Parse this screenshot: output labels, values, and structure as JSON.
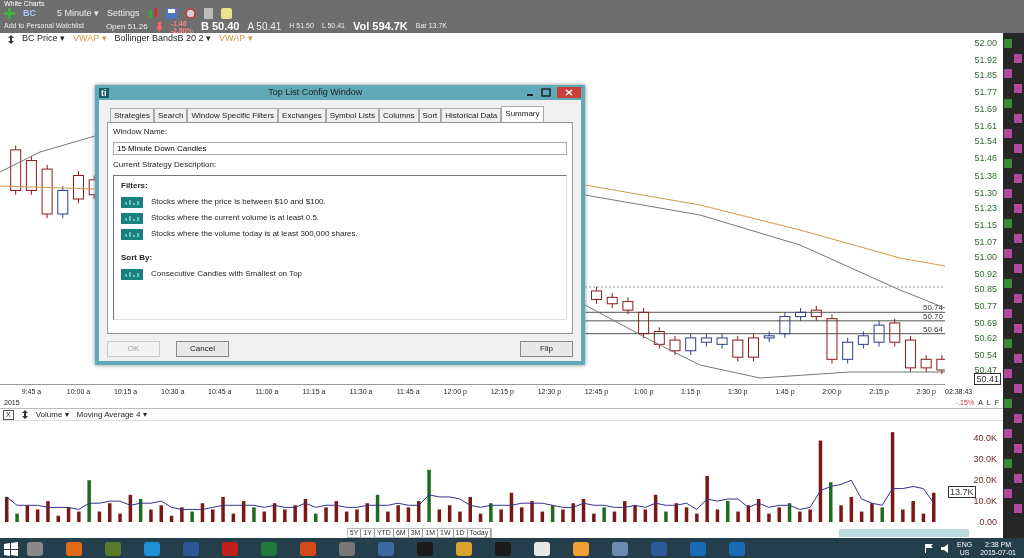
{
  "app_title": "White Charts",
  "toolbar": {
    "symbol": "BC",
    "interval": "5 Minute ▾",
    "settings": "Settings"
  },
  "quote": {
    "watchlist_link": "Add to Personal Watchlist",
    "open": "Open 51.26",
    "change": "-1.46",
    "change_pct": "-2.80%",
    "bid": "B 50.40",
    "ask": "A 50.41",
    "high": "H 51.50",
    "low": "L 50.41",
    "volume": "Vol 594.7K",
    "bar": "Bar 13.7K"
  },
  "price_chart": {
    "indicators": [
      {
        "label": "BC Price ▾"
      },
      {
        "label": "VWAP ▾",
        "color": "#d19a45"
      },
      {
        "label": "Bollinger BandsB 20 2 ▾"
      },
      {
        "label": "VWAP ▾",
        "color": "#d19a45"
      }
    ],
    "level_labels": [
      "50.74",
      "50.70",
      "50.64"
    ],
    "last_price": "50.41",
    "change_pct": "-.15%",
    "time": "02:38:43",
    "flags": [
      "A",
      "L",
      "F"
    ],
    "year": "2015",
    "chart_data": {
      "type": "candlestick",
      "x": [
        580,
        585,
        590,
        595,
        600,
        605,
        765,
        770,
        775,
        780,
        785,
        790,
        795,
        800,
        805,
        810,
        815,
        820,
        825,
        830,
        835,
        840,
        845,
        850,
        855,
        860,
        865,
        870,
        875
      ],
      "ohlc": [
        [
          51.5,
          51.52,
          51.29,
          51.31
        ],
        [
          51.45,
          51.47,
          51.29,
          51.31
        ],
        [
          51.41,
          51.43,
          51.18,
          51.2
        ],
        [
          51.2,
          51.33,
          51.18,
          51.31
        ],
        [
          51.38,
          51.4,
          51.25,
          51.27
        ],
        [
          51.36,
          51.38,
          51.27,
          51.29
        ],
        [
          50.84,
          50.86,
          50.78,
          50.8
        ],
        [
          50.81,
          50.83,
          50.76,
          50.78
        ],
        [
          50.79,
          50.81,
          50.73,
          50.75
        ],
        [
          50.74,
          50.76,
          50.62,
          50.64
        ],
        [
          50.65,
          50.67,
          50.57,
          50.59
        ],
        [
          50.61,
          50.63,
          50.54,
          50.56
        ],
        [
          50.56,
          50.64,
          50.54,
          50.62
        ],
        [
          50.6,
          50.64,
          50.58,
          50.62
        ],
        [
          50.59,
          50.64,
          50.57,
          50.62
        ],
        [
          50.61,
          50.63,
          50.51,
          50.53
        ],
        [
          50.62,
          50.64,
          50.51,
          50.53
        ],
        [
          50.62,
          50.65,
          50.6,
          50.63
        ],
        [
          50.64,
          50.74,
          50.62,
          50.72
        ],
        [
          50.72,
          50.76,
          50.7,
          50.74
        ],
        [
          50.75,
          50.77,
          50.7,
          50.72
        ],
        [
          50.71,
          50.73,
          50.5,
          50.52
        ],
        [
          50.52,
          50.62,
          50.5,
          50.6
        ],
        [
          50.59,
          50.65,
          50.57,
          50.63
        ],
        [
          50.6,
          50.7,
          50.58,
          50.68
        ],
        [
          50.69,
          50.71,
          50.58,
          50.6
        ],
        [
          50.61,
          50.63,
          50.46,
          50.48
        ],
        [
          50.52,
          50.54,
          50.46,
          50.48
        ],
        [
          50.52,
          50.54,
          50.45,
          50.47
        ]
      ],
      "xlim": [
        575,
        876
      ],
      "ylim": [
        50.47,
        52.0
      ],
      "xticks": [
        {
          "value": 585,
          "label": "9:45 a"
        },
        {
          "value": 600,
          "label": "10:00 a"
        },
        {
          "value": 615,
          "label": "10:15 a"
        },
        {
          "value": 630,
          "label": "10:30 a"
        },
        {
          "value": 645,
          "label": "10:45 a"
        },
        {
          "value": 660,
          "label": "11:00 a"
        },
        {
          "value": 675,
          "label": "11:15 a"
        },
        {
          "value": 690,
          "label": "11:30 a"
        },
        {
          "value": 705,
          "label": "11:45 a"
        },
        {
          "value": 720,
          "label": "12:00 p"
        },
        {
          "value": 735,
          "label": "12:15 p"
        },
        {
          "value": 750,
          "label": "12:30 p"
        },
        {
          "value": 765,
          "label": "12:45 p"
        },
        {
          "value": 780,
          "label": "1:00 p"
        },
        {
          "value": 795,
          "label": "1:15 p"
        },
        {
          "value": 810,
          "label": "1:30 p"
        },
        {
          "value": 825,
          "label": "1:45 p"
        },
        {
          "value": 840,
          "label": "2:00 p"
        },
        {
          "value": 855,
          "label": "2:15 p"
        },
        {
          "value": 870,
          "label": "2:30 p"
        }
      ],
      "yticks": [
        {
          "value": 52.0,
          "label": "52.00"
        },
        {
          "value": 51.92,
          "label": "51.92"
        },
        {
          "value": 51.85,
          "label": "51.85"
        },
        {
          "value": 51.77,
          "label": "51.77"
        },
        {
          "value": 51.69,
          "label": "51.69"
        },
        {
          "value": 51.61,
          "label": "51.61"
        },
        {
          "value": 51.54,
          "label": "51.54"
        },
        {
          "value": 51.46,
          "label": "51.46"
        },
        {
          "value": 51.38,
          "label": "51.38"
        },
        {
          "value": 51.3,
          "label": "51.30"
        },
        {
          "value": 51.23,
          "label": "51.23"
        },
        {
          "value": 51.15,
          "label": "51.15"
        },
        {
          "value": 51.07,
          "label": "51.07"
        },
        {
          "value": 51.0,
          "label": "51.00"
        },
        {
          "value": 50.92,
          "label": "50.92"
        },
        {
          "value": 50.85,
          "label": "50.85"
        },
        {
          "value": 50.77,
          "label": "50.77"
        },
        {
          "value": 50.69,
          "label": "50.69"
        },
        {
          "value": 50.62,
          "label": "50.62"
        },
        {
          "value": 50.54,
          "label": "50.54"
        },
        {
          "value": 50.47,
          "label": "50.47"
        }
      ]
    }
  },
  "volume_chart": {
    "close": "X",
    "indicators": [
      "Volume ▾"
    ],
    "ma_caret": "▾",
    "last_volume": "13.7K",
    "chart_data": {
      "type": "bar",
      "stacked": true,
      "ylim": [
        0,
        45000
      ],
      "yticks": [
        {
          "value": 40000,
          "label": "40.0K"
        },
        {
          "value": 30000,
          "label": "30.0K"
        },
        {
          "value": 20000,
          "label": "20.0K"
        },
        {
          "value": 10000,
          "label": "10.0K"
        },
        {
          "value": 0,
          "label": "0.00"
        }
      ],
      "series": [
        {
          "color": "#7a1818",
          "values": [
            12000,
            null,
            8000,
            6000,
            10000,
            3000,
            7000,
            5000,
            null,
            5000,
            9000,
            4000,
            13000,
            null,
            6000,
            8000,
            3000,
            7000,
            null,
            9000,
            6000,
            12000,
            4000,
            10000,
            null,
            5000,
            9000,
            6000,
            8000,
            11000,
            null,
            7000,
            10000,
            5000,
            6000,
            9000,
            null,
            5000,
            8000,
            7000,
            10000,
            null,
            6000,
            8000,
            5000,
            12000,
            4000,
            null,
            6000,
            14000,
            7000,
            10000,
            5000,
            null,
            6000,
            9000,
            11000,
            4000,
            null,
            5000,
            10000,
            8000,
            6000,
            13000,
            null,
            9000,
            7000,
            4000,
            22000,
            6000,
            null,
            5000,
            8000,
            11000,
            4000,
            7000,
            null,
            5000,
            6000,
            39000,
            null,
            8000,
            12000,
            5000,
            9000,
            null,
            43000,
            6000,
            10000,
            4000,
            14000
          ]
        },
        {
          "color": "#1f6b1f",
          "values": [
            null,
            4000,
            null,
            null,
            null,
            null,
            null,
            null,
            20000,
            null,
            null,
            null,
            null,
            11000,
            null,
            null,
            null,
            null,
            5000,
            null,
            null,
            null,
            null,
            null,
            7000,
            null,
            null,
            null,
            null,
            null,
            4000,
            null,
            null,
            null,
            null,
            null,
            13000,
            null,
            null,
            null,
            null,
            25000,
            null,
            null,
            null,
            null,
            null,
            9000,
            null,
            null,
            null,
            null,
            null,
            8000,
            null,
            null,
            null,
            null,
            7000,
            null,
            null,
            null,
            null,
            null,
            5000,
            null,
            null,
            null,
            null,
            null,
            10000,
            null,
            null,
            null,
            null,
            null,
            9000,
            null,
            null,
            null,
            19000,
            null,
            null,
            null,
            null,
            7000,
            null,
            null,
            null,
            null,
            null
          ]
        },
        {
          "name": "Moving Average 4",
          "type": "line",
          "color": "#33338a",
          "values": [
            12000,
            8000,
            8000,
            8000,
            7000,
            7000,
            7000,
            6000,
            9000,
            9000,
            10000,
            10000,
            8000,
            9000,
            9000,
            10000,
            7000,
            6000,
            6000,
            6000,
            7000,
            8000,
            8000,
            8000,
            8000,
            7000,
            8000,
            7000,
            7000,
            9000,
            7000,
            8000,
            8000,
            7000,
            7000,
            8000,
            8000,
            8000,
            9000,
            8000,
            8000,
            13000,
            12000,
            12000,
            11000,
            8000,
            7000,
            8000,
            8000,
            8000,
            9000,
            9000,
            9000,
            8000,
            7000,
            7000,
            9000,
            8000,
            8000,
            7000,
            7000,
            8000,
            7000,
            9000,
            8000,
            8000,
            9000,
            6000,
            11000,
            10000,
            11000,
            11000,
            7000,
            9000,
            7000,
            8000,
            8000,
            6000,
            7000,
            15000,
            17000,
            18000,
            20000,
            11000,
            9000,
            8000,
            16000,
            16000,
            17000,
            16000,
            9000
          ]
        }
      ]
    }
  },
  "range_bar": [
    "5Y",
    "1Y",
    "YTD",
    "6M",
    "3M",
    "1M",
    "1W",
    "1D",
    "Today"
  ],
  "dialog": {
    "logo": "ti",
    "title": "Top List Config Window",
    "tabs": [
      {
        "label": "Strategies",
        "selected": false
      },
      {
        "label": "Search",
        "selected": false
      },
      {
        "label": "Window Specific Filters",
        "selected": false
      },
      {
        "label": "Exchanges",
        "selected": false
      },
      {
        "label": "Symbol Lists",
        "selected": false
      },
      {
        "label": "Columns",
        "selected": false
      },
      {
        "label": "Sort",
        "selected": false
      },
      {
        "label": "Historical Data",
        "selected": false
      },
      {
        "label": "Summary",
        "selected": true
      }
    ],
    "window_name_label": "Window Name:",
    "window_name": "15 Minute Down Candles",
    "description_label": "Current Strategy Description:",
    "filters_heading": "Filters:",
    "filters": [
      "Stocks where the price is between $10 and $100.",
      "Stocks where the current volume is at least 0.5.",
      "Stocks where the volume today is at least 300,000 shares."
    ],
    "sort_heading": "Sort By:",
    "sort": [
      "Consecutive Candles with Smallest on Top"
    ],
    "buttons": [
      {
        "label": "OK",
        "disabled": true
      },
      {
        "label": "Cancel",
        "disabled": false
      },
      {
        "label": "Flip",
        "disabled": false
      }
    ]
  },
  "taskbar": {
    "language": "ENG",
    "region": "US",
    "time": "2:38 PM",
    "date": "2015-07-01"
  }
}
